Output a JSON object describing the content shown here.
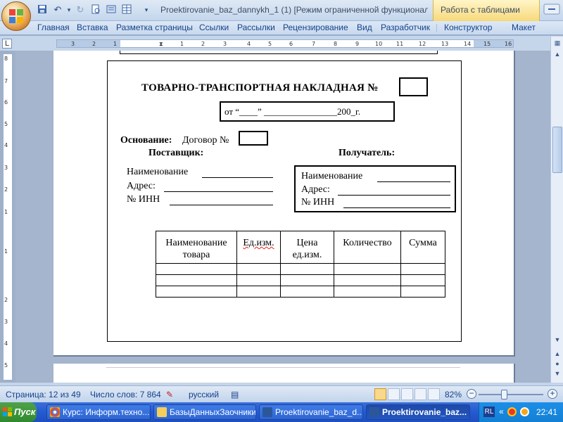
{
  "window": {
    "title": "Proektirovanie_baz_dannykh_1 (1) [Режим ограниченной функционал...",
    "context_tab": "Работа с таблицами"
  },
  "ribbon": {
    "tabs": [
      "Главная",
      "Вставка",
      "Разметка страницы",
      "Ссылки",
      "Рассылки",
      "Рецензирование",
      "Вид",
      "Разработчик",
      "Конструктор",
      "Макет"
    ]
  },
  "ruler": {
    "corner": "L",
    "ticks": [
      "3",
      "2",
      "1",
      "1",
      "2",
      "3",
      "4",
      "5",
      "6",
      "7",
      "8",
      "9",
      "10",
      "11",
      "12",
      "13",
      "14",
      "15",
      "16"
    ]
  },
  "vruler": {
    "ticks": [
      "8",
      "7",
      "6",
      "5",
      "4",
      "3",
      "2",
      "1",
      "1",
      "2",
      "3",
      "4",
      "5"
    ]
  },
  "document": {
    "title": "ТОВАРНО-ТРАНСПОРТНАЯ  НАКЛАДНАЯ  №",
    "date_line": "от “____” ________________200_г.",
    "basis_label": "Основание:",
    "basis_text": "Договор №",
    "supplier_heading": "Поставщик:",
    "receiver_heading": "Получатель:",
    "supplier_fields": [
      "Наименование",
      "Адрес:",
      "№ ИНН"
    ],
    "receiver_fields": [
      "Наименование",
      "Адрес:",
      "№ ИНН"
    ],
    "table": {
      "headers": [
        "Наименование товара",
        "Ед.изм.",
        "Цена ед.изм.",
        "Количество",
        "Сумма"
      ],
      "rows": 3
    }
  },
  "status": {
    "page": "Страница: 12 из 49",
    "words": "Число слов: 7 864",
    "language": "русский",
    "zoom": "82%",
    "zoom_level_percent": 82
  },
  "taskbar": {
    "start": "Пуск",
    "tasks": [
      "Курс: Информ.техно...",
      "БазыДанныхЗаочники",
      "Proektirovanie_baz_d...",
      "Proektirovanie_baz..."
    ],
    "lang": "RL",
    "clock": "22:41"
  },
  "colors": {
    "ribbon_text": "#15428b",
    "context_tab": "#f6d97a",
    "taskbar": "#245ad1",
    "start_button": "#2f8a2d"
  }
}
